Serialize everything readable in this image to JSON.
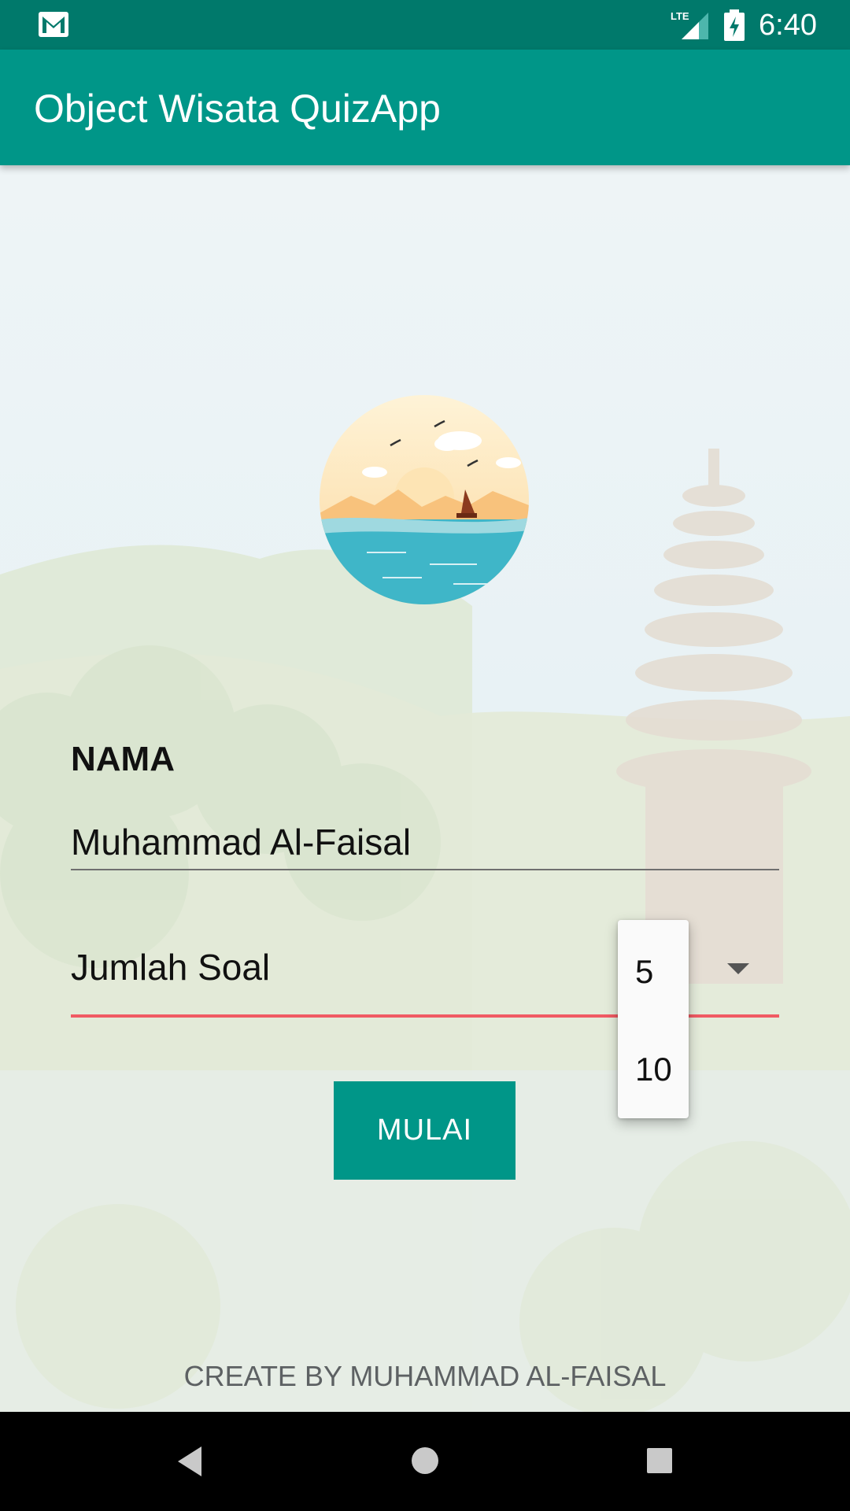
{
  "status_bar": {
    "time": "6:40",
    "icons": [
      "gmail-icon",
      "lte-signal-icon",
      "battery-charging-icon"
    ]
  },
  "app_bar": {
    "title": "Object Wisata QuizApp"
  },
  "form": {
    "name_label": "NAMA",
    "name_value": "Muhammad Al-Faisal",
    "soal_label": "Jumlah Soal",
    "soal_options": [
      "5",
      "10"
    ],
    "start_label": "MULAI"
  },
  "footer": {
    "credit": "CREATE BY MUHAMMAD AL-FAISAL"
  },
  "colors": {
    "status_bar": "#00796b",
    "app_bar": "#009688",
    "accent_error": "#f05a63",
    "button": "#009688"
  },
  "nav_bar": {
    "icons": [
      "back-icon",
      "home-icon",
      "recents-icon"
    ]
  }
}
